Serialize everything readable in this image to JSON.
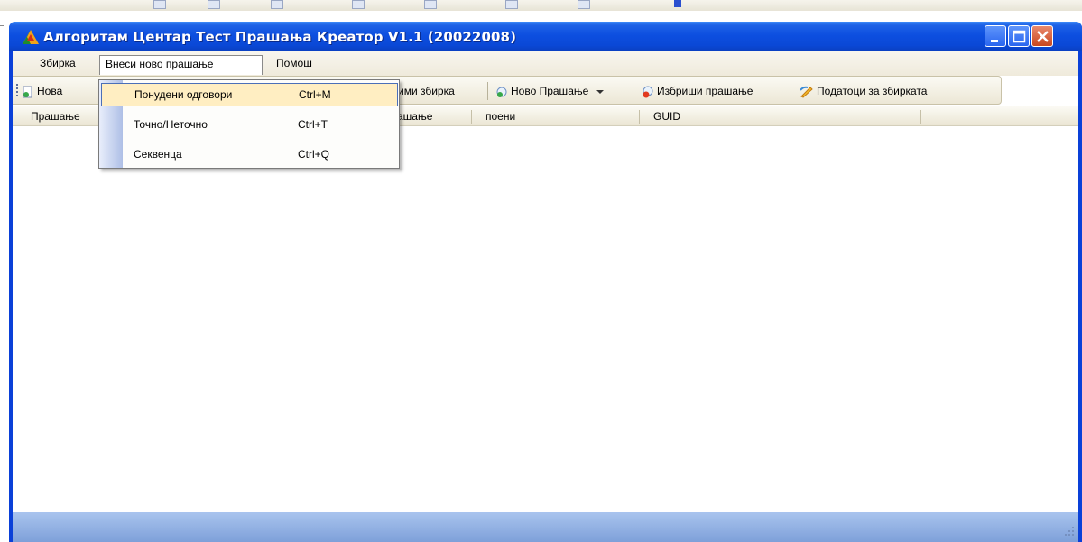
{
  "window": {
    "title": "Алгоритам Центар Тест Прашања Креатор V1.1 (20022008)"
  },
  "menubar": {
    "items": [
      {
        "label": "Збирка"
      },
      {
        "label": "Внеси ново прашање"
      },
      {
        "label": "Помош"
      }
    ]
  },
  "toolbar": {
    "new_label": "Нова",
    "save_suffix": "ими збирка",
    "new_question_label": "Ново Прашање",
    "delete_question_label": "Избриши прашање",
    "collection_data_label": "Податоци за збирката"
  },
  "list": {
    "columns": [
      "Прашање",
      "ашање",
      "поени",
      "GUID"
    ]
  },
  "dropdown": {
    "items": [
      {
        "label": "Понудени одговори",
        "shortcut": "Ctrl+M"
      },
      {
        "label": "Точно/Неточно",
        "shortcut": "Ctrl+T"
      },
      {
        "label": "Секвенца",
        "shortcut": "Ctrl+Q"
      }
    ]
  },
  "colors": {
    "titlebar": "#0a48d6",
    "menu_highlight": "#ffeec2",
    "statusbar": "#7ea0d9"
  }
}
